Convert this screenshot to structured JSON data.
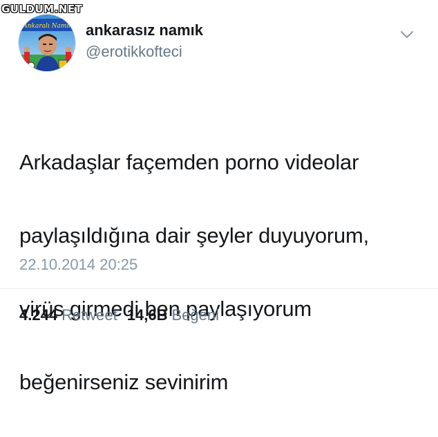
{
  "watermark": "GULDUM.NET",
  "avatar": {
    "caption": "Ankaralı Namık",
    "icon": "profile-avatar"
  },
  "user": {
    "display_name": "ankarasız namık",
    "handle": "@erotikkofteci"
  },
  "menu_icon": "chevron-down-icon",
  "tweet": {
    "lines": [
      "Arkadaşlar façemden porno videolar",
      "paylaşıldığına dair şeyler duyuyorum,",
      "virüs girmedi ben paylaşıyorum",
      "beğenirseniz sevinirim"
    ],
    "timestamp": "22.10.2014 20:25"
  },
  "stats": {
    "retweets_count": "4.244",
    "retweets_label": "Retweet",
    "likes_count": "14,6B",
    "likes_label": "Beğeni"
  },
  "colors": {
    "text": "#14171a",
    "secondary": "#657786",
    "timestamp": "#8899a6",
    "divider": "#e6ecf0"
  }
}
